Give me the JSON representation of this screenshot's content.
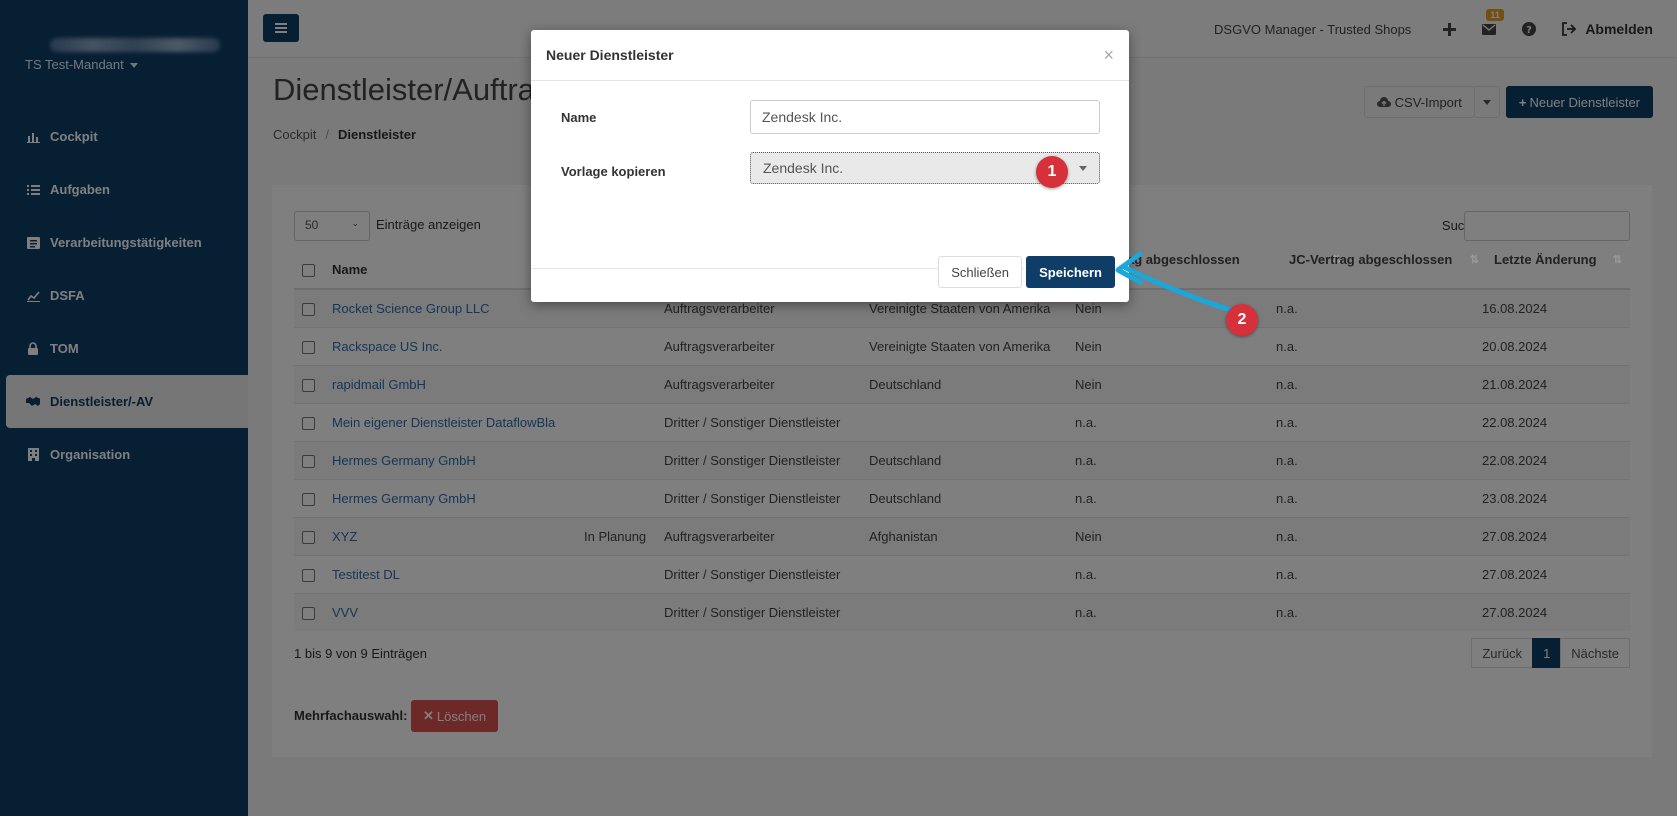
{
  "sidebar": {
    "tenant": "TS Test-Mandant",
    "items": [
      {
        "label": "Cockpit",
        "icon": "bar-chart-icon"
      },
      {
        "label": "Aufgaben",
        "icon": "list-icon"
      },
      {
        "label": "Verarbeitungstätigkeiten",
        "icon": "list-alt-icon"
      },
      {
        "label": "DSFA",
        "icon": "line-chart-icon"
      },
      {
        "label": "TOM",
        "icon": "lock-icon"
      },
      {
        "label": "Dienstleister/-AV",
        "icon": "handshake-icon",
        "active": true
      },
      {
        "label": "Organisation",
        "icon": "building-icon"
      }
    ]
  },
  "topbar": {
    "title": "DSGVO Manager - Trusted Shops",
    "badge_count": "11",
    "logout_label": "Abmelden"
  },
  "page": {
    "title": "Dienstleister/Auftrag",
    "breadcrumb": [
      "Cockpit",
      "Dienstleister"
    ],
    "csv_import_label": "CSV-Import",
    "new_label": "Neuer Dienstleister"
  },
  "list": {
    "length_value": "50",
    "length_label": "Einträge anzeigen",
    "search_label": "Suchen",
    "columns": [
      "Name",
      "ag abgeschlossen",
      "JC-Vertrag abgeschlossen",
      "Letzte Änderung"
    ],
    "rows": [
      {
        "name": "Rocket Science Group LLC",
        "status": "",
        "type": "Auftragsverarbeiter",
        "country": "Vereinigte Staaten von Amerika",
        "av": "Nein",
        "jc": "n.a.",
        "date": "16.08.2024"
      },
      {
        "name": "Rackspace US Inc.",
        "status": "",
        "type": "Auftragsverarbeiter",
        "country": "Vereinigte Staaten von Amerika",
        "av": "Nein",
        "jc": "n.a.",
        "date": "20.08.2024"
      },
      {
        "name": "rapidmail GmbH",
        "status": "",
        "type": "Auftragsverarbeiter",
        "country": "Deutschland",
        "av": "Nein",
        "jc": "n.a.",
        "date": "21.08.2024"
      },
      {
        "name": "Mein eigener Dienstleister DataflowBla",
        "status": "",
        "type": "Dritter / Sonstiger Dienstleister",
        "country": "",
        "av": "n.a.",
        "jc": "n.a.",
        "date": "22.08.2024"
      },
      {
        "name": "Hermes Germany GmbH",
        "status": "",
        "type": "Dritter / Sonstiger Dienstleister",
        "country": "Deutschland",
        "av": "n.a.",
        "jc": "n.a.",
        "date": "22.08.2024"
      },
      {
        "name": "Hermes Germany GmbH",
        "status": "",
        "type": "Dritter / Sonstiger Dienstleister",
        "country": "Deutschland",
        "av": "n.a.",
        "jc": "n.a.",
        "date": "23.08.2024"
      },
      {
        "name": "XYZ",
        "status": "In Planung",
        "type": "Auftragsverarbeiter",
        "country": "Afghanistan",
        "av": "Nein",
        "jc": "n.a.",
        "date": "27.08.2024"
      },
      {
        "name": "Testitest DL",
        "status": "",
        "type": "Dritter / Sonstiger Dienstleister",
        "country": "",
        "av": "n.a.",
        "jc": "n.a.",
        "date": "27.08.2024"
      },
      {
        "name": "VVV",
        "status": "",
        "type": "Dritter / Sonstiger Dienstleister",
        "country": "",
        "av": "n.a.",
        "jc": "n.a.",
        "date": "27.08.2024"
      }
    ],
    "info": "1 bis 9 von 9 Einträgen",
    "prev_label": "Zurück",
    "current_page": "1",
    "next_label": "Nächste",
    "multi_label": "Mehrfachauswahl:",
    "delete_label": "Löschen"
  },
  "modal": {
    "title": "Neuer Dienstleister",
    "close_symbol": "×",
    "name_label": "Name",
    "name_value": "Zendesk Inc.",
    "template_label": "Vorlage kopieren",
    "template_value": "Zendesk Inc.",
    "close_label": "Schließen",
    "save_label": "Speichern"
  },
  "annotations": {
    "marker1": "1",
    "marker2": "2",
    "marker_color": "#d6313a",
    "arrow_color": "#1aa7dc"
  }
}
